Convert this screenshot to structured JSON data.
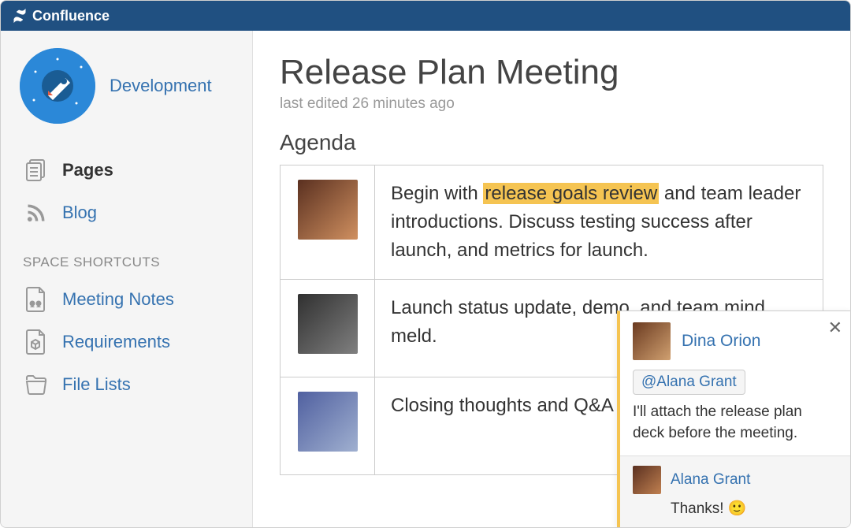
{
  "app": {
    "name": "Confluence"
  },
  "sidebar": {
    "space": "Development",
    "nav": [
      {
        "label": "Pages",
        "active": true
      },
      {
        "label": "Blog",
        "active": false
      }
    ],
    "shortcuts_header": "SPACE SHORTCUTS",
    "shortcuts": [
      {
        "label": "Meeting Notes"
      },
      {
        "label": "Requirements"
      },
      {
        "label": "File Lists"
      }
    ]
  },
  "page": {
    "title": "Release Plan Meeting",
    "meta": "last edited 26 minutes ago",
    "agenda_heading": "Agenda",
    "rows": [
      {
        "text_before": "Begin with ",
        "highlight": "release goals review",
        "text_after": " and team leader introductions. Discuss testing success after launch, and metrics for launch."
      },
      {
        "text": "Launch status update, demo, and team mind meld."
      },
      {
        "text": "Closing thoughts and Q&A with the team leader."
      }
    ]
  },
  "comment": {
    "author": "Dina Orion",
    "mention": "@Alana Grant",
    "body": "I'll attach the release plan deck before the meeting.",
    "reply": {
      "author": "Alana Grant",
      "body": "Thanks! 🙂"
    }
  }
}
